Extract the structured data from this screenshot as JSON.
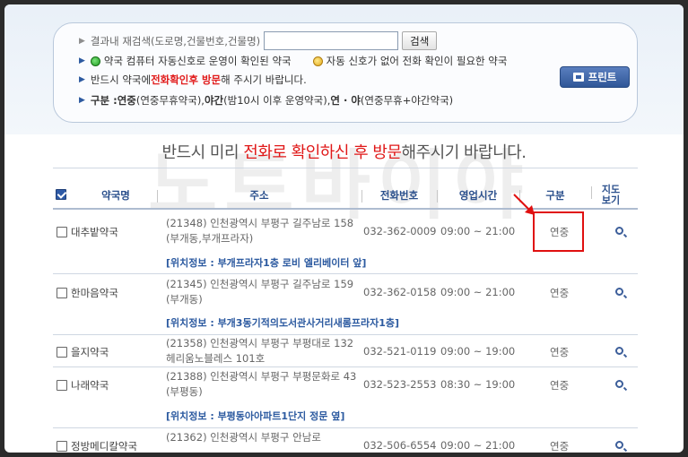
{
  "search": {
    "label": "결과내 재검색(도로명,건물번호,건물명)",
    "placeholder": "",
    "value": "",
    "button": "검색"
  },
  "legend": {
    "green_text": "약국 컴퓨터 자동신호로 운영이 확인된 약국",
    "yellow_text": "자동 신호가 없어 전화 확인이 필요한 약국"
  },
  "visit_notice": {
    "prefix": "반드시 약국에 ",
    "highlight": "전화확인후 방문",
    "suffix": "해 주시기 바랍니다."
  },
  "type_legend": {
    "label": "구분 : ",
    "t1": "연중",
    "t1_desc": "(연중무휴약국), ",
    "t2": "야간",
    "t2_desc": "(밤10시 이후 운영약국), ",
    "t3": "연 · 야",
    "t3_desc": "(연중무휴+야간약국)"
  },
  "print_button": "프린트",
  "watermark": "노트바이야",
  "banner": {
    "pre": "반드시 미리 ",
    "hl": "전화로 확인하신 후 방문",
    "post": "해주시기 바랍니다."
  },
  "table": {
    "headers": {
      "name": "약국명",
      "address": "주소",
      "phone": "전화번호",
      "hours": "영업시간",
      "type": "구분",
      "map_line1": "지도",
      "map_line2": "보기"
    },
    "rows": [
      {
        "name": "대추밭약국",
        "address": "(21348) 인천광역시 부평구 길주남로 158 (부개동,부개프라자)",
        "phone": "032-362-0009",
        "hours": "09:00 ~ 21:00",
        "type": "연중",
        "location": "[위치정보 : 부개프라자1층 로비 엘리베이터 앞]"
      },
      {
        "name": "한마음약국",
        "address": "(21345) 인천광역시 부평구 길주남로 159 (부개동)",
        "phone": "032-362-0158",
        "hours": "09:00 ~ 21:00",
        "type": "연중",
        "location": "[위치정보 : 부개3동기적의도서관사거리새롬프라자1층]"
      },
      {
        "name": "을지약국",
        "address": "(21358) 인천광역시 부평구 부평대로 132 헤리움노블레스 101호",
        "phone": "032-521-0119",
        "hours": "09:00 ~ 19:00",
        "type": "연중",
        "location": ""
      },
      {
        "name": "나래약국",
        "address": "(21388) 인천광역시 부평구 부평문화로 43 (부평동)",
        "phone": "032-523-2553",
        "hours": "08:30 ~ 19:00",
        "type": "연중",
        "location": "[위치정보 : 부평동아아파트1단지 정문 옆]"
      },
      {
        "name": "정방메디칼약국",
        "address": "(21362) 인천광역시 부평구 안남로",
        "phone": "032-506-6554",
        "hours": "09:00 ~ 21:00",
        "type": "연중",
        "location": ""
      }
    ]
  },
  "colors": {
    "accent_blue": "#2c5aa0",
    "highlight_red": "#e01818"
  }
}
